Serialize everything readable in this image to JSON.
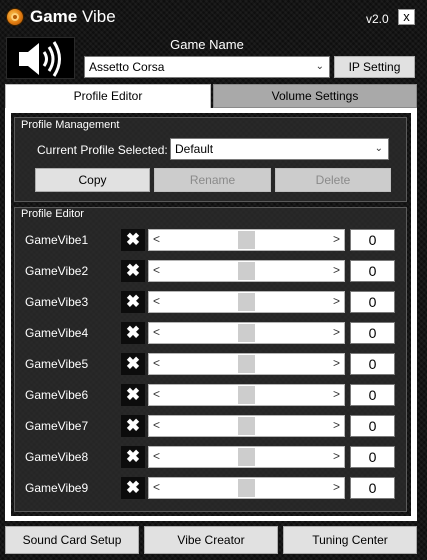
{
  "window": {
    "title_bold": "Game",
    "title_rest": " Vibe",
    "version": "v2.0",
    "close_label": "x"
  },
  "header": {
    "speaker_icon": "speaker-volume-icon",
    "game_name_label": "Game Name",
    "game_selected": "Assetto Corsa",
    "ip_setting_label": "IP Setting"
  },
  "tabs": [
    {
      "label": "Profile Editor",
      "active": true
    },
    {
      "label": "Volume Settings",
      "active": false
    }
  ],
  "profile_management": {
    "title": "Profile Management",
    "current_label": "Current Profile Selected:",
    "current_value": "Default",
    "copy_label": "Copy",
    "rename_label": "Rename",
    "delete_label": "Delete"
  },
  "profile_editor": {
    "title": "Profile Editor",
    "rows": [
      {
        "label": "GameVibe1",
        "value": "0",
        "level": 0.5
      },
      {
        "label": "GameVibe2",
        "value": "0",
        "level": 0.5
      },
      {
        "label": "GameVibe3",
        "value": "0",
        "level": 0.5
      },
      {
        "label": "GameVibe4",
        "value": "0",
        "level": 0.5
      },
      {
        "label": "GameVibe5",
        "value": "0",
        "level": 0.5
      },
      {
        "label": "GameVibe6",
        "value": "0",
        "level": 0.5
      },
      {
        "label": "GameVibe7",
        "value": "0",
        "level": 0.5
      },
      {
        "label": "GameVibe8",
        "value": "0",
        "level": 0.5
      },
      {
        "label": "GameVibe9",
        "value": "0",
        "level": 0.5
      }
    ]
  },
  "footer": {
    "sound_card_label": "Sound Card Setup",
    "vibe_creator_label": "Vibe Creator",
    "tuning_center_label": "Tuning Center"
  },
  "colors": {
    "background": "#151515",
    "button": "#e1e1e1",
    "active_tab": "#ffffff",
    "inactive_tab": "#a9a9a9",
    "logo_accent": "#e07a10"
  }
}
